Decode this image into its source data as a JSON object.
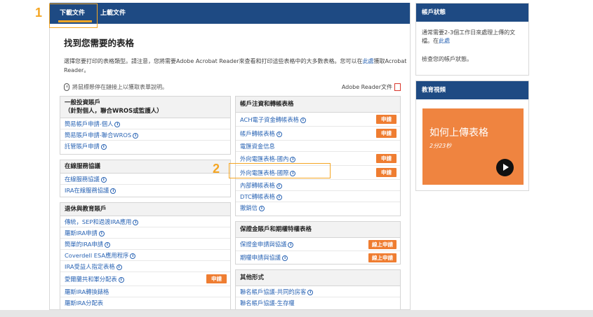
{
  "tabs": {
    "download": "下載文件",
    "upload": "上載文件"
  },
  "heading": "找到您需要的表格",
  "intro": {
    "text": "選擇您要打印的表格類型。請注意，您將需要Adobe Acrobat Reader來查看和打印這些表格中的大多數表格。您可以在",
    "link": "此處",
    "text2": "獲取Acrobat Reader。"
  },
  "hint": "將鼠標懸停在鏈接上以獲取表單說明。",
  "reader_doc": "Adobe Reader文件",
  "pdf_icon": "PDF",
  "info_glyph": "i",
  "annotations": {
    "one": "1",
    "two": "2"
  },
  "buttons": {
    "apply": "申請",
    "online_apply": "線上申請"
  },
  "sections": {
    "general": {
      "title": "一般投資賬戶",
      "subtitle": "（針對個人，聯合WROS或監護人）",
      "items": [
        "簡易帳戶申請-個人",
        "簡易賬戶申請-聯合WROS",
        "託管賬戶申請"
      ]
    },
    "online": {
      "title": "在線服務協議",
      "items": [
        "在線服務協議",
        "IRA在線服務協議"
      ]
    },
    "retire": {
      "title": "退休與教育賬戶",
      "items": [
        "傳統，SEP和過渡IRA應用",
        "羅斯IRA申請",
        "簡單的IRA申請",
        "Coverdell ESA應用程序",
        "IRA受益人指定表格",
        "愛爾蘭共和軍分配表",
        "羅斯IRA轉換錶格",
        "羅斯IRA分配表"
      ]
    },
    "transfer": {
      "title": "帳戶注資和轉帳表格",
      "items": [
        "ACH電子資金轉帳表格",
        "帳戶轉帳表格",
        "電匯資金信息",
        "外向電匯表格-國內",
        "外向電匯表格-國際",
        "內部轉帳表格",
        "DTC轉帳表格",
        "撤銷信"
      ]
    },
    "margin": {
      "title": "保證金賬戶和期權特權表格",
      "items": [
        "保證金申請與協議",
        "期權申請與協議"
      ]
    },
    "other": {
      "title": "其他形式",
      "items": [
        "聯名帳戶協議-共同的房客",
        "聯名帳戶協議-生存權"
      ]
    }
  },
  "sidebar": {
    "status": {
      "title": "帳戶狀態",
      "text": "通常需要2-3個工作日來處理上傳的文檔。在",
      "link": "此處",
      "text2": "檢查您的帳戶狀態。"
    },
    "video": {
      "title": "教育視頻",
      "card_title": "如何上傳表格",
      "duration": "2分23秒"
    }
  }
}
